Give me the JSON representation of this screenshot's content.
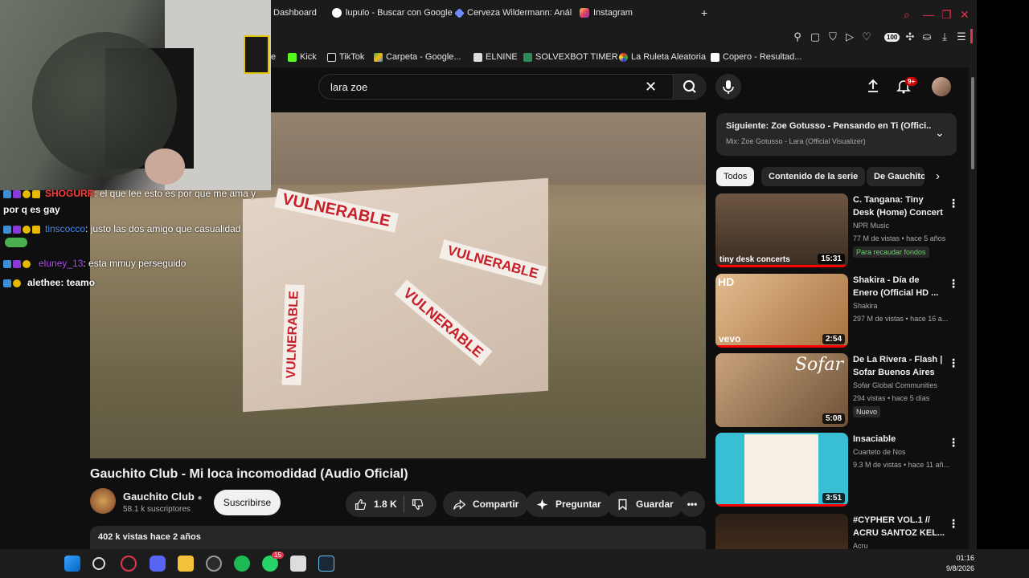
{
  "browser": {
    "tabs": [
      {
        "label": "Dashboard"
      },
      {
        "label": "lupulo - Buscar con Google"
      },
      {
        "label": "Cerveza Wildermann: Anál"
      },
      {
        "label": "Instagram"
      }
    ],
    "new_tab": "+",
    "extension_badge": "100",
    "bookmarks": [
      {
        "label": "e"
      },
      {
        "label": "Kick"
      },
      {
        "label": "TikTok"
      },
      {
        "label": "Carpeta - Google..."
      },
      {
        "label": "ELNINE"
      },
      {
        "label": "SOLVEXBOT TIMER"
      },
      {
        "label": "La Ruleta Aleatoria"
      },
      {
        "label": "Copero - Resultad..."
      }
    ]
  },
  "youtube": {
    "search": {
      "value": "lara zoe"
    },
    "notifications_badge": "9+",
    "video": {
      "title": "Gauchito Club - Mi loca incomodidad (Audio Oficial)",
      "channel": "Gauchito Club",
      "subscribers": "58.1 k suscriptores",
      "subscribe_label": "Suscribirse",
      "likes": "1.8 K",
      "share_label": "Compartir",
      "ask_label": "Preguntar",
      "save_label": "Guardar",
      "stats": "402 k vistas  hace 2 años",
      "tape_word": "VULNERABLE"
    },
    "up_next": {
      "title": "Siguiente: Zoe Gotusso - Pensando en Ti (Offici...",
      "subtitle": "Mix: Zoe Gotusso - Lara (Official Visualizer)"
    },
    "chips": [
      "Todos",
      "Contenido de la serie",
      "De Gauchito"
    ],
    "recommendations": [
      {
        "title": "C. Tangana: Tiny Desk (Home) Concert",
        "channel": "NPR Music",
        "meta": "77 M de vistas • hace 5 años",
        "tag": "Para recaudar fondos",
        "duration": "15:31",
        "thumb_label": "tiny desk concerts",
        "color": "#5a4a3c"
      },
      {
        "title": "Shakira - Día de Enero (Official HD ...",
        "channel": "Shakira",
        "meta": "297 M de vistas • hace 16 a...",
        "tag": "",
        "duration": "2:54",
        "thumb_label": "vevo",
        "color": "#c99a6c"
      },
      {
        "title": "De La Rivera - Flash | Sofar Buenos Aires",
        "channel": "Sofar Global Communities",
        "meta": "294 vistas • hace 5 días",
        "tag": "Nuevo",
        "duration": "5:08",
        "thumb_label": "Sofar",
        "color": "#b08a66"
      },
      {
        "title": "Insaciable",
        "channel": "Cuarteto de Nos",
        "meta": "9.3 M de vistas • hace 11 añ...",
        "tag": "",
        "duration": "3:51",
        "thumb_label": "",
        "color": "#39bfd4"
      },
      {
        "title": "#CYPHER VOL.1 // ACRU SANTOZ KEL...",
        "channel": "Acru",
        "meta": "",
        "tag": "",
        "duration": "",
        "thumb_label": "",
        "color": "#3b2b1f"
      }
    ]
  },
  "chat": [
    {
      "user": "SHOGURR",
      "user_color": "#ff3b3b",
      "msg": ": el que lee esto es por que me ama y"
    },
    {
      "user": "",
      "user_color": "#ffffff",
      "msg": "por q es gay"
    },
    {
      "user": "tinscocco",
      "user_color": "#4a8df0",
      "msg": ": justo las dos amigo que casualidad"
    },
    {
      "user": "eluney_13",
      "user_color": "#b44af0",
      "msg": ": esta mmuy perseguido"
    },
    {
      "user": "alethee",
      "user_color": "#ffffff",
      "msg": ": teamo"
    }
  ],
  "taskbar": {
    "whatsapp_badge": "15",
    "time": "01:16",
    "date": "9/8/2026"
  }
}
